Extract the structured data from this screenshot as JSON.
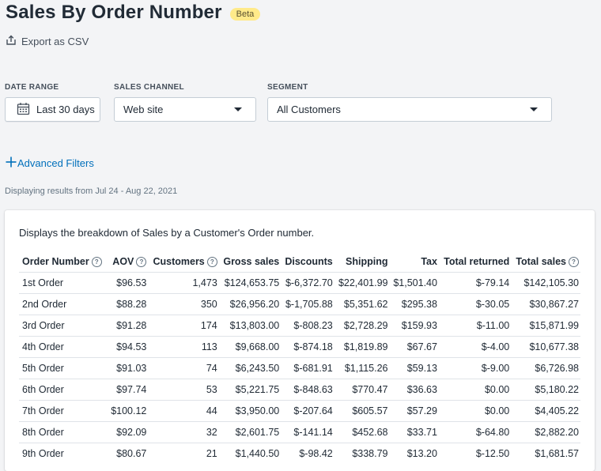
{
  "header": {
    "title": "Sales By Order Number",
    "badge": "Beta",
    "export_label": "Export as CSV"
  },
  "filters": {
    "date_range": {
      "label": "DATE RANGE",
      "value": "Last 30 days"
    },
    "sales_channel": {
      "label": "SALES CHANNEL",
      "value": "Web site"
    },
    "segment": {
      "label": "SEGMENT",
      "value": "All Customers"
    }
  },
  "advanced_filters": "Advanced Filters",
  "results_text": "Displaying results from Jul 24 - Aug 22, 2021",
  "card": {
    "description": "Displays the breakdown of Sales by a Customer's Order number.",
    "columns": [
      "Order Number",
      "AOV",
      "Customers",
      "Gross sales",
      "Discounts",
      "Shipping",
      "Tax",
      "Total returned",
      "Total sales"
    ],
    "help_columns": [
      0,
      1,
      2,
      8
    ],
    "rows": [
      [
        "1st Order",
        "$96.53",
        "1,473",
        "$124,653.75",
        "$-6,372.70",
        "$22,401.99",
        "$1,501.40",
        "$-79.14",
        "$142,105.30"
      ],
      [
        "2nd Order",
        "$88.28",
        "350",
        "$26,956.20",
        "$-1,705.88",
        "$5,351.62",
        "$295.38",
        "$-30.05",
        "$30,867.27"
      ],
      [
        "3rd Order",
        "$91.28",
        "174",
        "$13,803.00",
        "$-808.23",
        "$2,728.29",
        "$159.93",
        "$-11.00",
        "$15,871.99"
      ],
      [
        "4th Order",
        "$94.53",
        "113",
        "$9,668.00",
        "$-874.18",
        "$1,819.89",
        "$67.67",
        "$-4.00",
        "$10,677.38"
      ],
      [
        "5th Order",
        "$91.03",
        "74",
        "$6,243.50",
        "$-681.91",
        "$1,115.26",
        "$59.13",
        "$-9.00",
        "$6,726.98"
      ],
      [
        "6th Order",
        "$97.74",
        "53",
        "$5,221.75",
        "$-848.63",
        "$770.47",
        "$36.63",
        "$0.00",
        "$5,180.22"
      ],
      [
        "7th Order",
        "$100.12",
        "44",
        "$3,950.00",
        "$-207.64",
        "$605.57",
        "$57.29",
        "$0.00",
        "$4,405.22"
      ],
      [
        "8th Order",
        "$92.09",
        "32",
        "$2,601.75",
        "$-141.14",
        "$452.68",
        "$33.71",
        "$-64.80",
        "$2,882.20"
      ],
      [
        "9th Order",
        "$80.67",
        "21",
        "$1,440.50",
        "$-98.42",
        "$338.79",
        "$13.20",
        "$-12.50",
        "$1,681.57"
      ]
    ]
  },
  "colors": {
    "badge_bg": "#ffea8a",
    "link": "#006fbb",
    "page_bg": "#f3f4f6"
  }
}
